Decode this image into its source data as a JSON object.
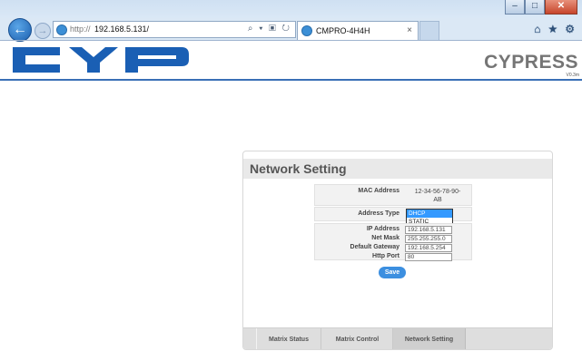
{
  "browser": {
    "url_prefix": "http://",
    "url_host": "192.168.5.131/",
    "tab_title": "CMPRO-4H4H",
    "tab_close": "×",
    "address_icons": "⌕ ▾ ▣ ↻",
    "toolbar_icons": [
      "home-icon",
      "star-icon",
      "gear-icon"
    ]
  },
  "header": {
    "brand": "CYPRESS",
    "version": "V0.3m"
  },
  "network": {
    "title": "Network Setting",
    "mac_label": "MAC Address",
    "mac_value": "12-34-56-78-90-AB",
    "address_type_label": "Address Type",
    "address_type_options": [
      "DHCP",
      "STATIC"
    ],
    "address_type_selected": "DHCP",
    "ip_label": "IP Address",
    "ip_value": "192.168.5.131",
    "netmask_label": "Net Mask",
    "netmask_value": "255.255.255.0",
    "gateway_label": "Default Gateway",
    "gateway_value": "192.168.5.254",
    "port_label": "Http Port",
    "port_value": "80",
    "save_label": "Save"
  },
  "tabs": [
    "Matrix Status",
    "Matrix Control",
    "Network Setting"
  ],
  "active_tab": "Network Setting",
  "colors": {
    "brand_blue": "#1a5fb4",
    "accent": "#3c8fe0",
    "selected_option": "#3399ff"
  }
}
